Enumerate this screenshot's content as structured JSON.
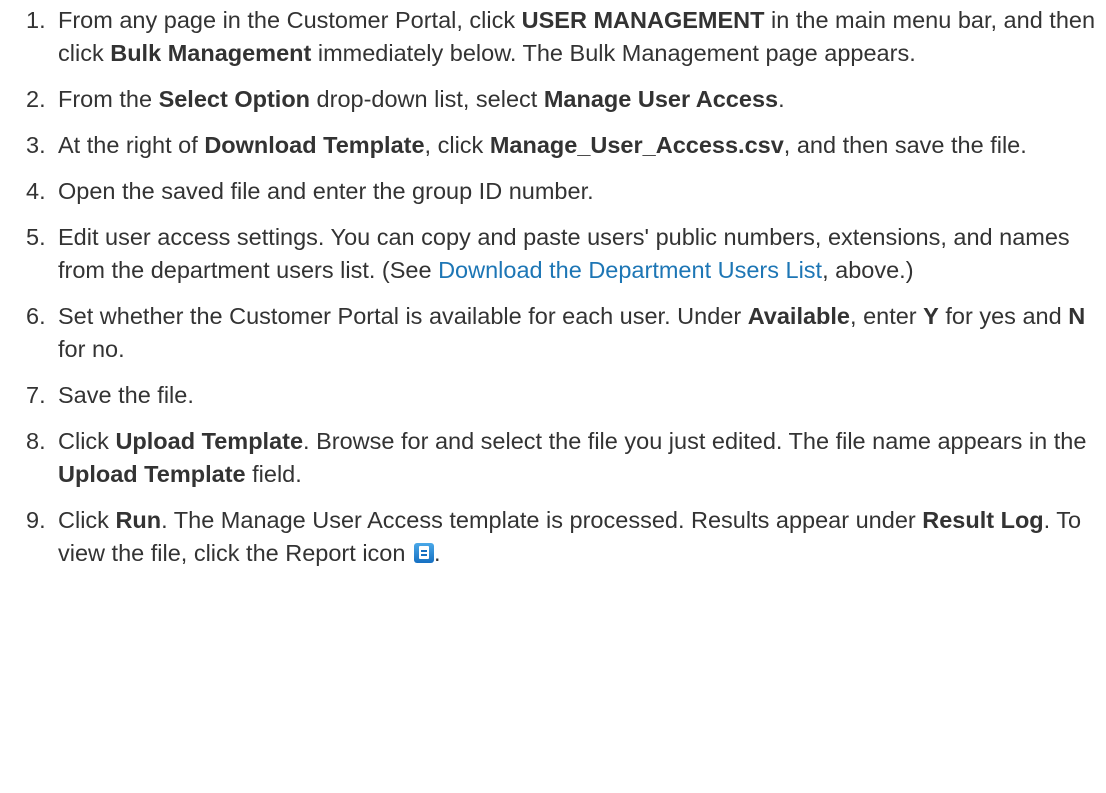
{
  "steps": [
    {
      "num": "1.",
      "parts": [
        {
          "t": "From any page in the Customer Portal, click "
        },
        {
          "t": "USER MANAGEMENT",
          "b": true
        },
        {
          "t": " in the main menu bar, and then click "
        },
        {
          "t": "Bulk Management",
          "b": true
        },
        {
          "t": " immediately below. The Bulk Management page appears."
        }
      ]
    },
    {
      "num": "2.",
      "parts": [
        {
          "t": "From the "
        },
        {
          "t": "Select Option",
          "b": true
        },
        {
          "t": " drop-down list, select "
        },
        {
          "t": "Manage User Access",
          "b": true
        },
        {
          "t": "."
        }
      ]
    },
    {
      "num": "3.",
      "parts": [
        {
          "t": "At the right of "
        },
        {
          "t": "Download Template",
          "b": true
        },
        {
          "t": ", click "
        },
        {
          "t": "Manage_User_Access.csv",
          "b": true
        },
        {
          "t": ", and then save the file."
        }
      ]
    },
    {
      "num": "4.",
      "parts": [
        {
          "t": "Open the saved file and enter the group ID number."
        }
      ]
    },
    {
      "num": "5.",
      "parts": [
        {
          "t": "Edit user access settings. You can copy and paste users' public numbers, extensions, and names from the department users list. (See "
        },
        {
          "t": "Download the Department Users List",
          "link": true
        },
        {
          "t": ", above.)"
        }
      ]
    },
    {
      "num": "6.",
      "parts": [
        {
          "t": "Set whether the Customer Portal is available for each user. Under "
        },
        {
          "t": "Available",
          "b": true
        },
        {
          "t": ", enter "
        },
        {
          "t": "Y",
          "b": true
        },
        {
          "t": " for yes and "
        },
        {
          "t": "N",
          "b": true
        },
        {
          "t": " for no."
        }
      ]
    },
    {
      "num": "7.",
      "parts": [
        {
          "t": "Save the file."
        }
      ]
    },
    {
      "num": "8.",
      "parts": [
        {
          "t": "Click "
        },
        {
          "t": "Upload Template",
          "b": true
        },
        {
          "t": ". Browse for and select the file you just edited. The file name appears in the "
        },
        {
          "t": "Upload Template",
          "b": true
        },
        {
          "t": " field."
        }
      ]
    },
    {
      "num": "9.",
      "parts": [
        {
          "t": "Click "
        },
        {
          "t": "Run",
          "b": true
        },
        {
          "t": ". The Manage User Access template is processed. Results appear under "
        },
        {
          "t": "Result Log",
          "b": true
        },
        {
          "t": ". To view the file, click the Report icon "
        },
        {
          "icon": "report-icon"
        },
        {
          "t": "."
        }
      ]
    }
  ],
  "colors": {
    "text": "#333333",
    "link": "#1d76b5",
    "icon": "#1670c2"
  }
}
